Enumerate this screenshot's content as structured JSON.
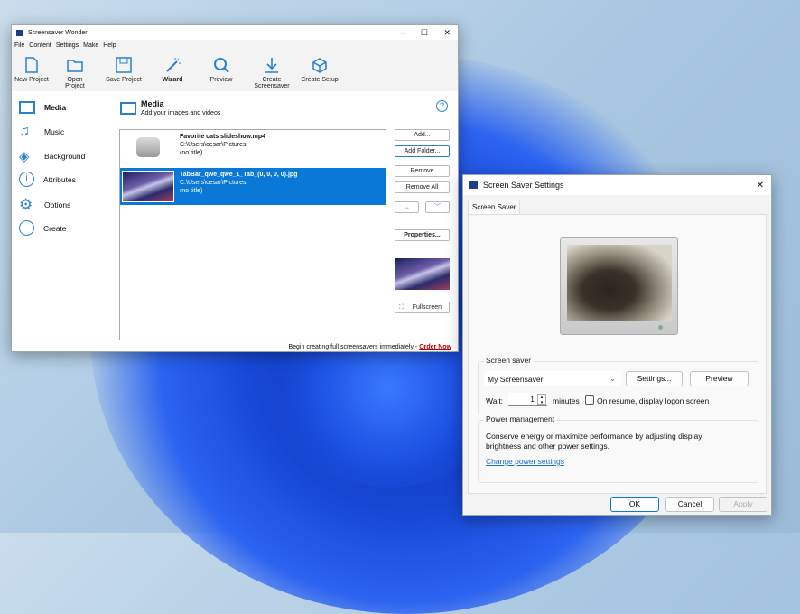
{
  "app": {
    "title": "Screensaver Wonder",
    "menu": [
      "File",
      "Content",
      "Settings",
      "Make",
      "Help"
    ],
    "toolbar": [
      "New Project",
      "Open Project",
      "Save Project",
      "Wizard",
      "Preview",
      "Create Screensaver",
      "Create Setup"
    ],
    "sidebar": [
      "Media",
      "Music",
      "Background",
      "Attributes",
      "Options",
      "Create"
    ],
    "section": {
      "title": "Media",
      "subtitle": "Add your images and videos"
    },
    "items": [
      {
        "name": "Favorite cats slideshow.mp4",
        "path": "C:\\Users\\cesar\\Pictures",
        "title": "(no title)"
      },
      {
        "name": "TabBar_qwe_qwe_1_Tab_(0, 0, 0, 0).jpg",
        "path": "C:\\Users\\cesar\\Pictures",
        "title": "(no title)"
      }
    ],
    "buttons": {
      "add": "Add...",
      "add_folder": "Add Folder...",
      "remove": "Remove",
      "remove_all": "Remove All",
      "properties": "Properties...",
      "fullscreen": "Fullscreen"
    },
    "footer": {
      "text": "Begin creating full screensavers immediately - ",
      "link": "Order Now"
    }
  },
  "dialog": {
    "title": "Screen Saver Settings",
    "tab": "Screen Saver",
    "group_screensaver": "Screen saver",
    "selected": "My Screensaver",
    "settings": "Settings...",
    "preview": "Preview",
    "wait_label": "Wait:",
    "wait_value": "1",
    "minutes": "minutes",
    "resume": "On resume, display logon screen",
    "group_power": "Power management",
    "power_text": "Conserve energy or maximize performance by adjusting display brightness and other power settings.",
    "power_link": "Change power settings",
    "ok": "OK",
    "cancel": "Cancel",
    "apply": "Apply"
  },
  "colors": {
    "accent": "#0a78d7",
    "selection": "#0a78d7",
    "link": "#1a6fc2",
    "order": "#c00000"
  }
}
